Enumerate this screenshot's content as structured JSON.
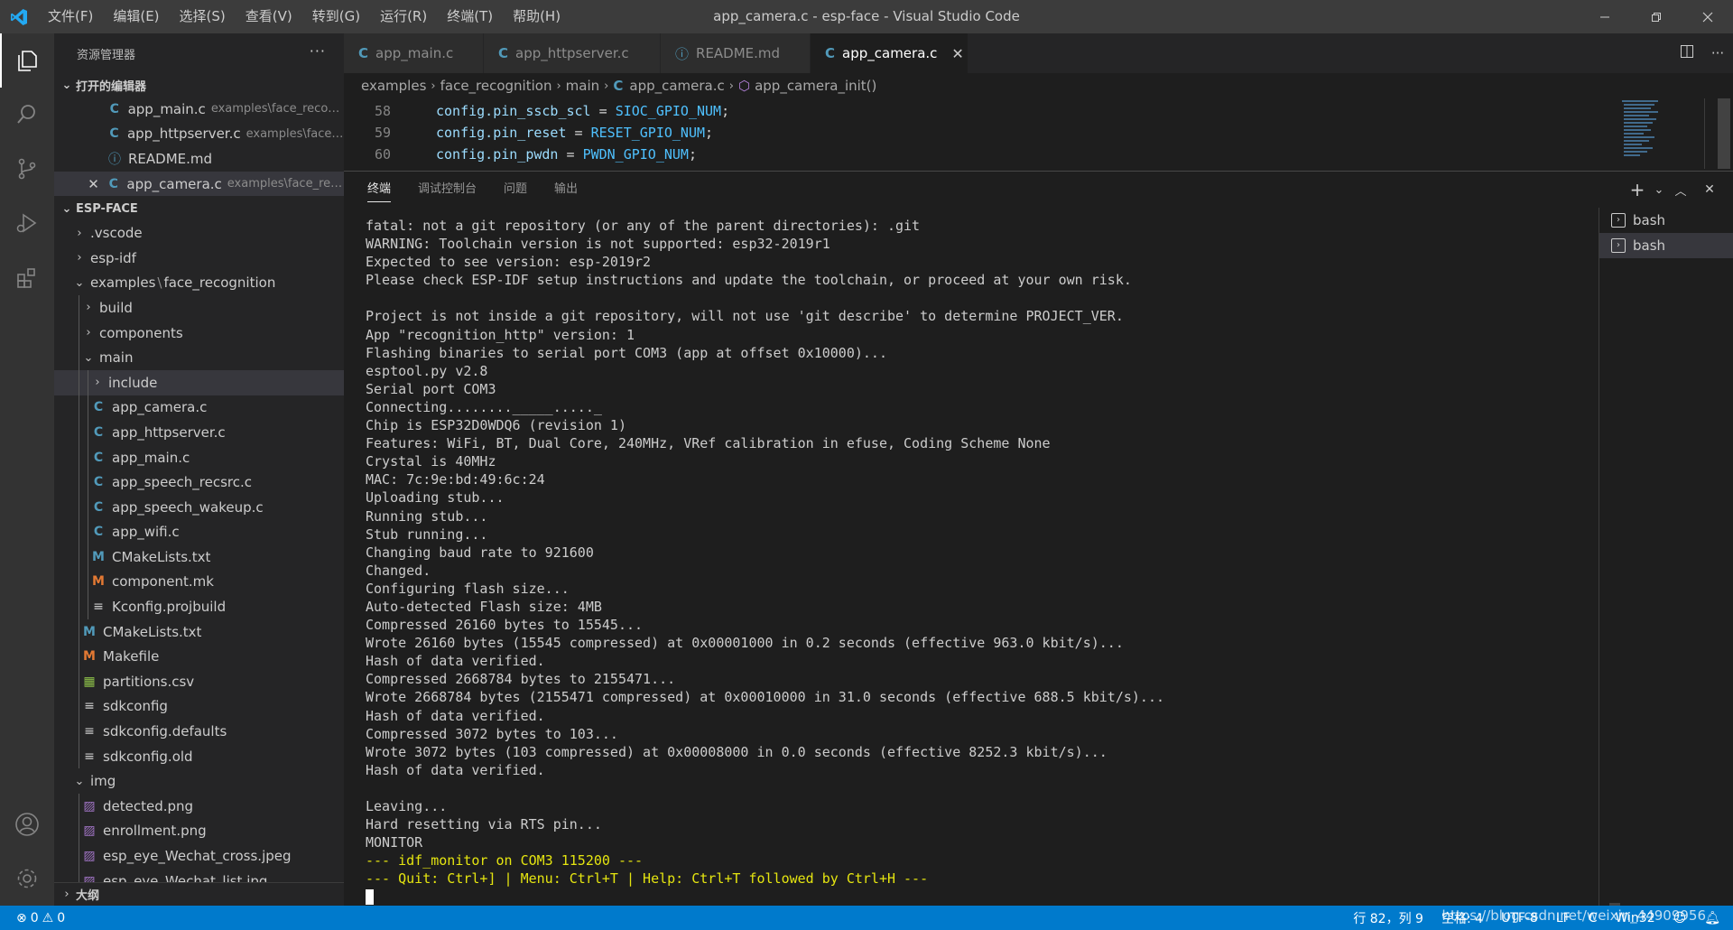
{
  "titlebar": {
    "menu": [
      "文件(F)",
      "编辑(E)",
      "选择(S)",
      "查看(V)",
      "转到(G)",
      "运行(R)",
      "终端(T)",
      "帮助(H)"
    ],
    "title": "app_camera.c - esp-face - Visual Studio Code"
  },
  "sidebar": {
    "header": "资源管理器",
    "open_editors_title": "打开的编辑器",
    "open_editors": [
      {
        "name": "app_main.c",
        "desc": "examples\\face_recog..."
      },
      {
        "name": "app_httpserver.c",
        "desc": "examples\\face_..."
      },
      {
        "name": "README.md",
        "desc": ""
      },
      {
        "name": "app_camera.c",
        "desc": "examples\\face_rec..."
      }
    ],
    "workspace_title": "ESP-FACE",
    "tree": {
      "vscode": ".vscode",
      "espidf": "esp-idf",
      "examples": "examples",
      "examples_sep": "\\",
      "face_recognition": "face_recognition",
      "build": "build",
      "components": "components",
      "main": "main",
      "include": "include",
      "app_camera": "app_camera.c",
      "app_httpserver": "app_httpserver.c",
      "app_main": "app_main.c",
      "app_speech_recsrc": "app_speech_recsrc.c",
      "app_speech_wakeup": "app_speech_wakeup.c",
      "app_wifi": "app_wifi.c",
      "cmake_main": "CMakeLists.txt",
      "component_mk": "component.mk",
      "kconfig": "Kconfig.projbuild",
      "cmake_root": "CMakeLists.txt",
      "makefile": "Makefile",
      "partitions": "partitions.csv",
      "sdkconfig": "sdkconfig",
      "sdkconfig_defaults": "sdkconfig.defaults",
      "sdkconfig_old": "sdkconfig.old",
      "img": "img",
      "detected": "detected.png",
      "enrollment": "enrollment.png",
      "wechat_cross": "esp_eye_Wechat_cross.jpeg",
      "wechat_list": "esp_eye_Wechat_list.jpg"
    },
    "outline_title": "大纲"
  },
  "tabs": [
    {
      "label": "app_main.c",
      "icon": "C"
    },
    {
      "label": "app_httpserver.c",
      "icon": "C"
    },
    {
      "label": "README.md",
      "icon": "ⓘ"
    },
    {
      "label": "app_camera.c",
      "icon": "C"
    }
  ],
  "breadcrumb": {
    "items": [
      "examples",
      "face_recognition",
      "main",
      "app_camera.c",
      "app_camera_init()"
    ]
  },
  "code": {
    "lines": [
      {
        "num": "58",
        "var": "config.pin_sscb_scl",
        "op": " = ",
        "const": "SIOC_GPIO_NUM",
        "end": ";"
      },
      {
        "num": "59",
        "var": "config.pin_reset",
        "op": " = ",
        "const": "RESET_GPIO_NUM",
        "end": ";"
      },
      {
        "num": "60",
        "var": "config.pin_pwdn",
        "op": " = ",
        "const": "PWDN_GPIO_NUM",
        "end": ";"
      }
    ]
  },
  "panel": {
    "tabs": [
      "终端",
      "调试控制台",
      "问题",
      "输出"
    ],
    "terminal_lines": [
      "fatal: not a git repository (or any of the parent directories): .git",
      "WARNING: Toolchain version is not supported: esp32-2019r1",
      "Expected to see version: esp-2019r2",
      "Please check ESP-IDF setup instructions and update the toolchain, or proceed at your own risk.",
      "",
      "Project is not inside a git repository, will not use 'git describe' to determine PROJECT_VER.",
      "App \"recognition_http\" version: 1",
      "Flashing binaries to serial port COM3 (app at offset 0x10000)...",
      "esptool.py v2.8",
      "Serial port COM3",
      "Connecting........_____....._",
      "Chip is ESP32D0WDQ6 (revision 1)",
      "Features: WiFi, BT, Dual Core, 240MHz, VRef calibration in efuse, Coding Scheme None",
      "Crystal is 40MHz",
      "MAC: 7c:9e:bd:49:6c:24",
      "Uploading stub...",
      "Running stub...",
      "Stub running...",
      "Changing baud rate to 921600",
      "Changed.",
      "Configuring flash size...",
      "Auto-detected Flash size: 4MB",
      "Compressed 26160 bytes to 15545...",
      "Wrote 26160 bytes (15545 compressed) at 0x00001000 in 0.2 seconds (effective 963.0 kbit/s)...",
      "Hash of data verified.",
      "Compressed 2668784 bytes to 2155471...",
      "Wrote 2668784 bytes (2155471 compressed) at 0x00010000 in 31.0 seconds (effective 688.5 kbit/s)...",
      "Hash of data verified.",
      "Compressed 3072 bytes to 103...",
      "Wrote 3072 bytes (103 compressed) at 0x00008000 in 0.0 seconds (effective 8252.3 kbit/s)...",
      "Hash of data verified.",
      "",
      "Leaving...",
      "Hard resetting via RTS pin...",
      "MONITOR"
    ],
    "monitor_lines": [
      "--- idf_monitor on COM3 115200 ---",
      "--- Quit: Ctrl+] | Menu: Ctrl+T | Help: Ctrl+T followed by Ctrl+H ---"
    ],
    "terminals": [
      "bash",
      "bash"
    ]
  },
  "statusbar": {
    "errors": "0",
    "warnings": "0",
    "position": "行 82，列 9",
    "spaces": "空格: 4",
    "encoding": "UTF-8",
    "eol": "LF",
    "lang": "C",
    "platform": "Win32",
    "watermark": "https://blog.csdn.net/weixin_44909956"
  },
  "colors": {
    "accent": "#007acc",
    "titlebar": "#3c3c3c",
    "sidebar": "#252526",
    "editor": "#1e1e1e",
    "monitor_yellow": "#e5e510"
  }
}
